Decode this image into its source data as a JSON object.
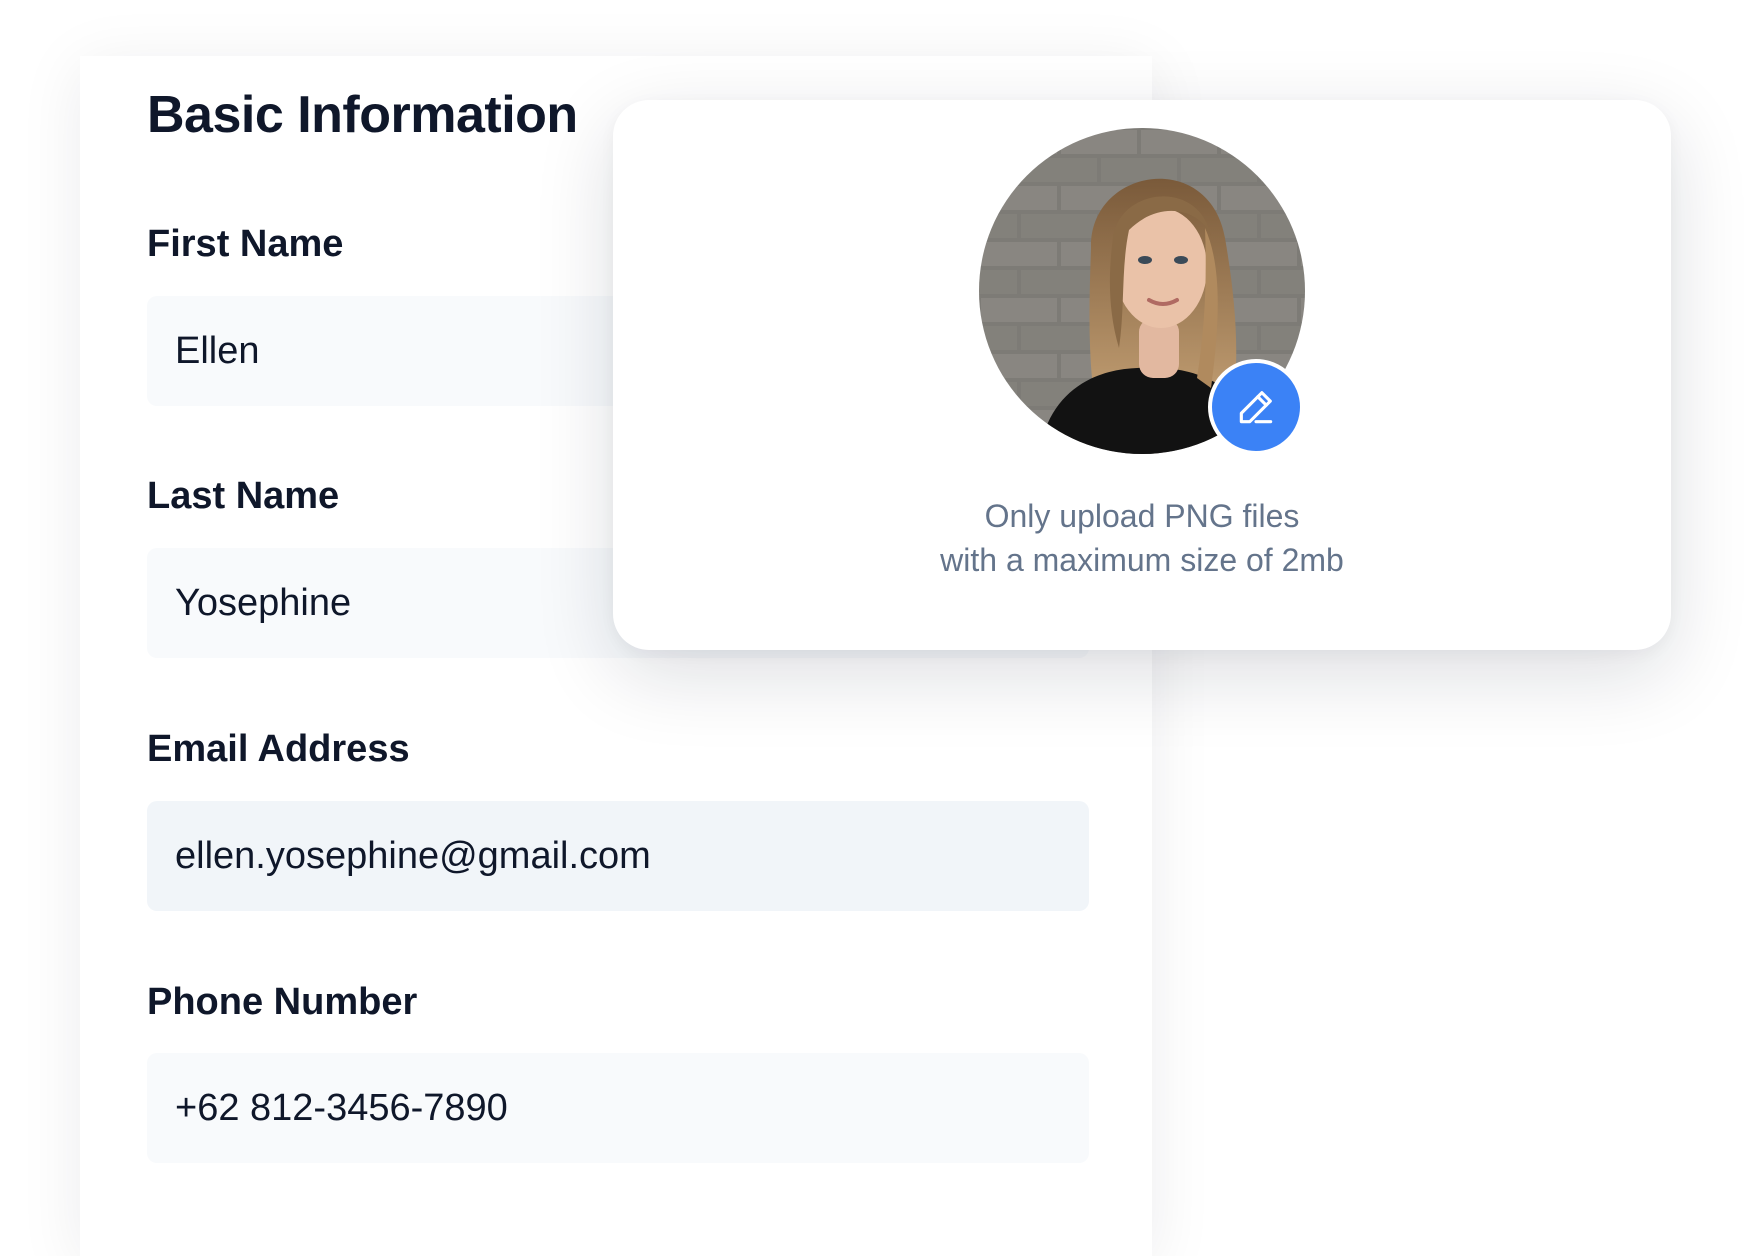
{
  "section": {
    "title": "Basic Information"
  },
  "fields": {
    "first_name": {
      "label": "First Name",
      "value": "Ellen"
    },
    "last_name": {
      "label": "Last Name",
      "value": "Yosephine"
    },
    "email": {
      "label": "Email Address",
      "value": "ellen.yosephine@gmail.com"
    },
    "phone": {
      "label": "Phone Number",
      "value": "+62 812-3456-7890"
    }
  },
  "upload": {
    "hint_line1": "Only upload PNG files",
    "hint_line2": "with a maximum size of 2mb",
    "edit_icon": "pencil-icon"
  },
  "colors": {
    "accent": "#3b82f6",
    "text_primary": "#0f172a",
    "text_muted": "#64748b",
    "input_bg": "#f8fafc",
    "input_bg_active": "#f1f5f9"
  }
}
